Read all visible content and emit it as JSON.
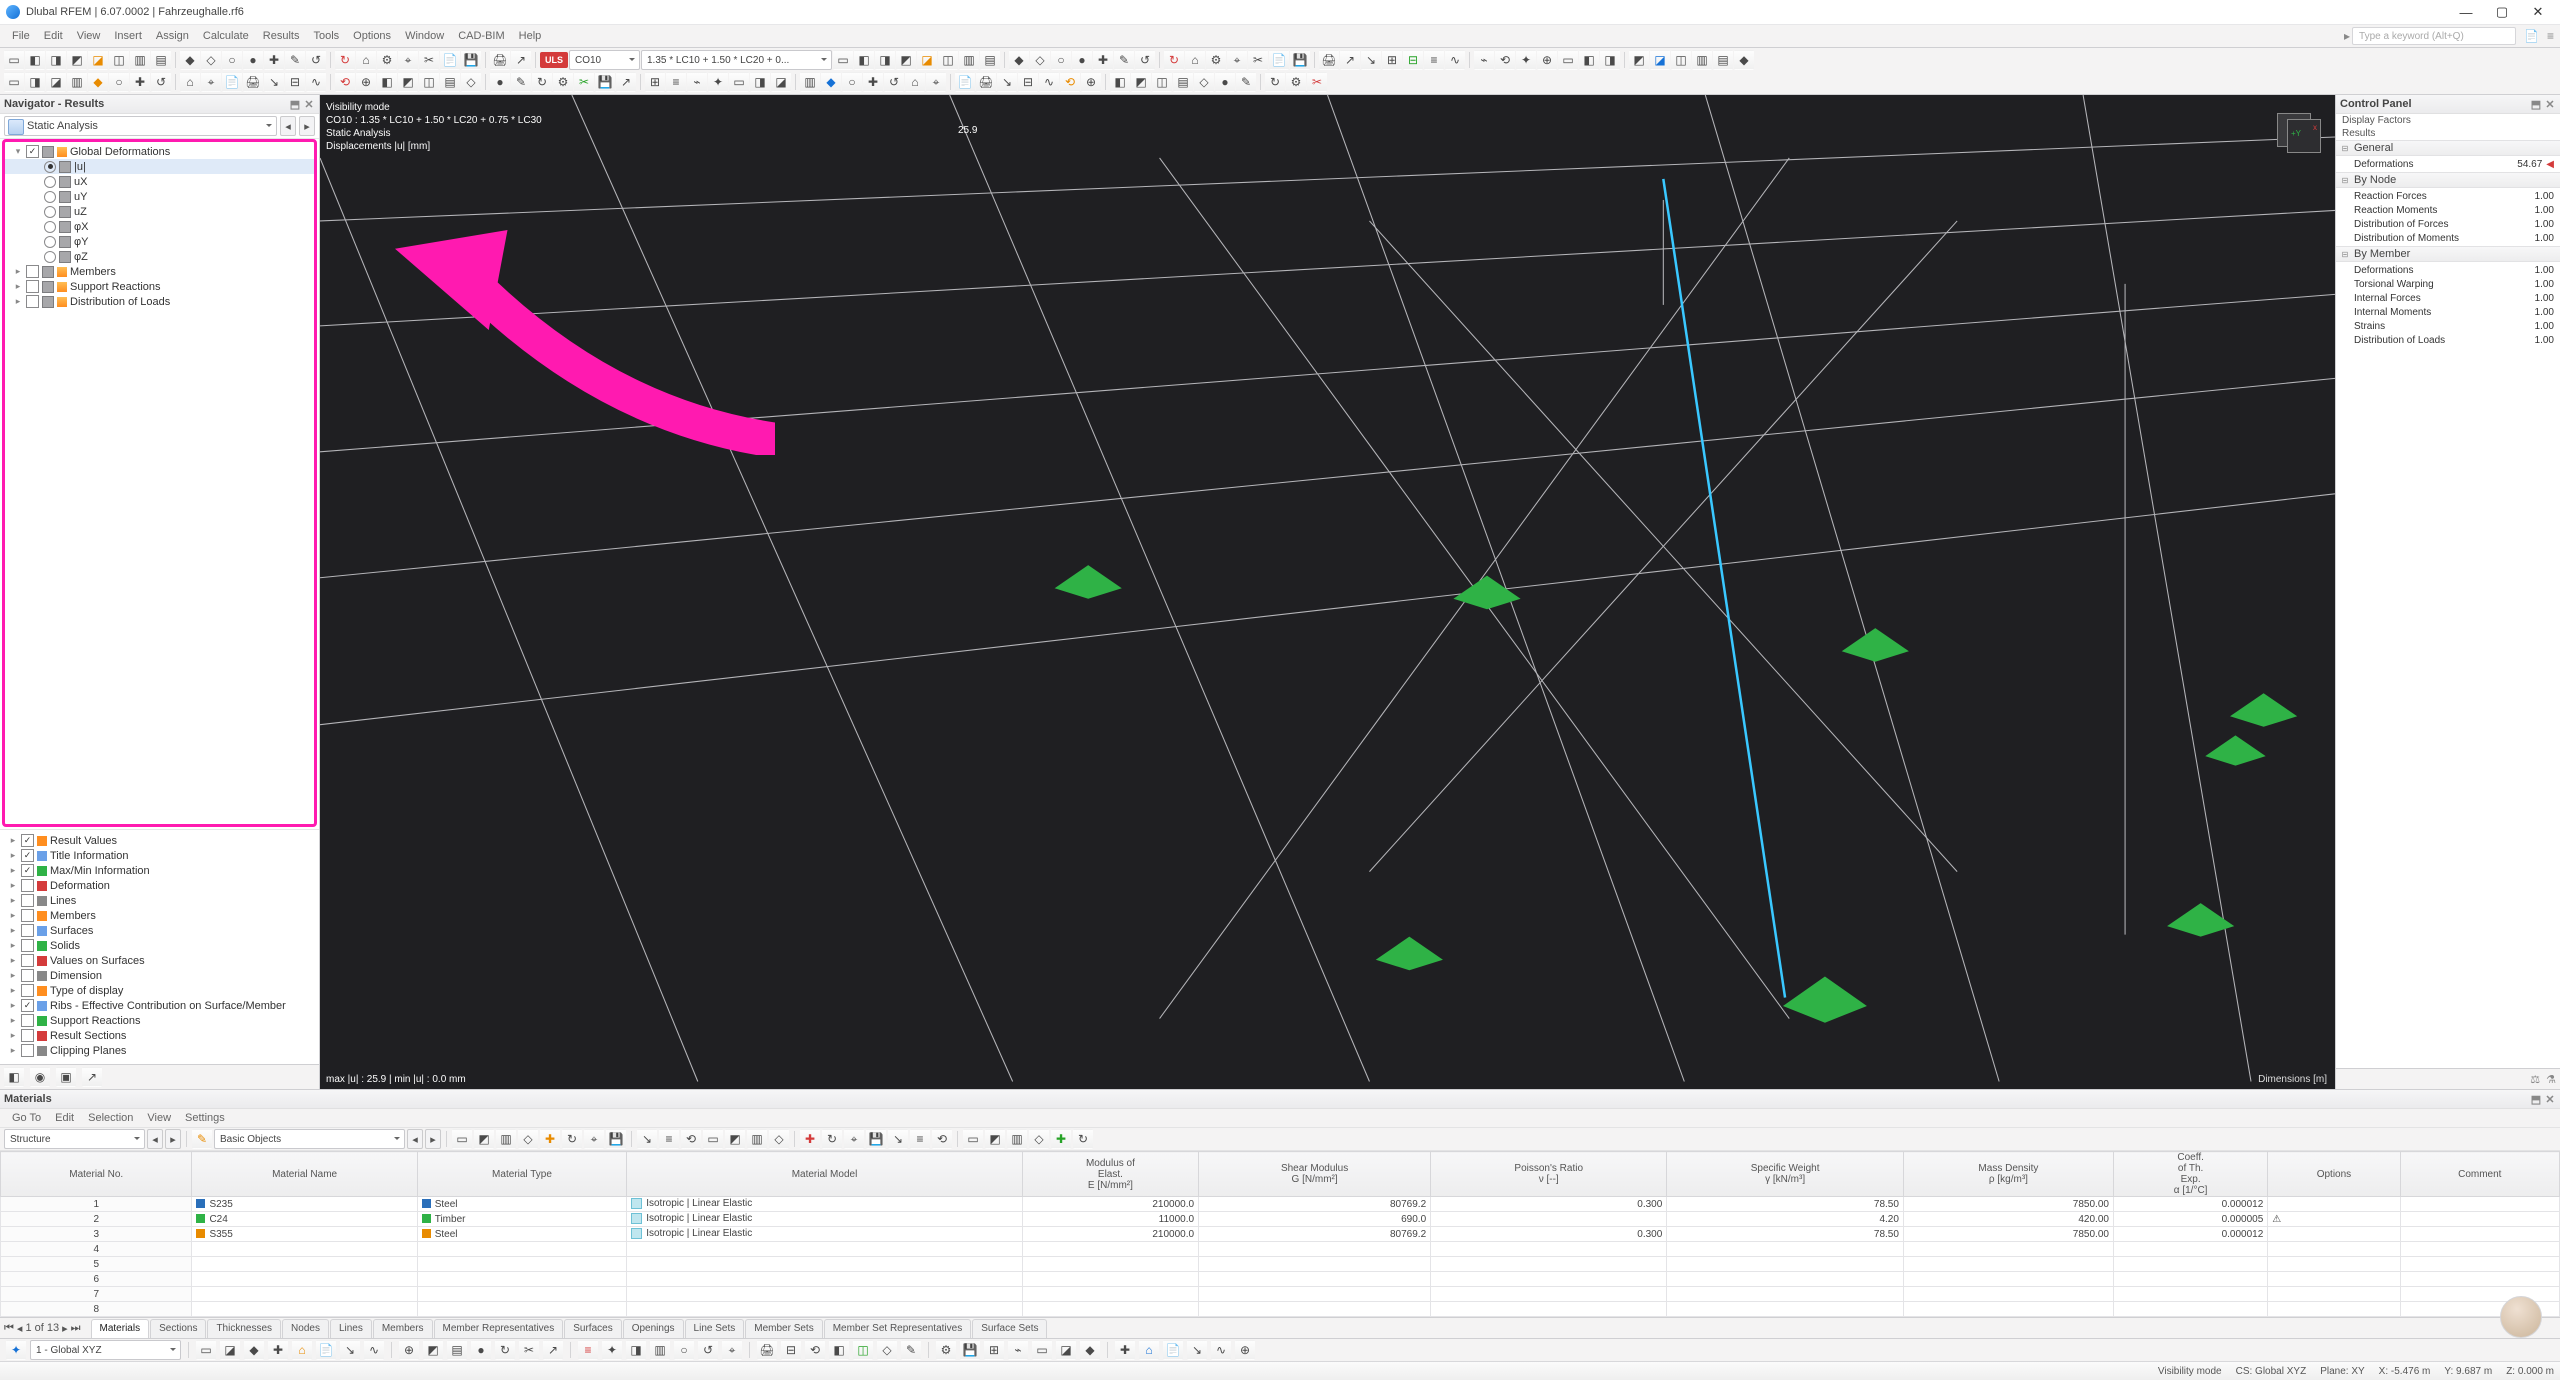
{
  "title": "Dlubal RFEM | 6.07.0002 | Fahrzeughalle.rf6",
  "menu": [
    "File",
    "Edit",
    "View",
    "Insert",
    "Assign",
    "Calculate",
    "Results",
    "Tools",
    "Options",
    "Window",
    "CAD-BIM",
    "Help"
  ],
  "search_placeholder": "Type a keyword (Alt+Q)",
  "uls_tag": "ULS",
  "combo_co": "CO10",
  "combo_formula": "1.35 * LC10 + 1.50 * LC20 + 0...",
  "left_panel": {
    "title": "Navigator - Results",
    "selector": "Static Analysis",
    "global_def": "Global Deformations",
    "deform_opts": [
      "|u|",
      "uX",
      "uY",
      "uZ",
      "φX",
      "φY",
      "φZ"
    ],
    "more_items": [
      "Members",
      "Support Reactions",
      "Distribution of Loads"
    ],
    "lower_items": [
      "Result Values",
      "Title Information",
      "Max/Min Information",
      "Deformation",
      "Lines",
      "Members",
      "Surfaces",
      "Solids",
      "Values on Surfaces",
      "Dimension",
      "Type of display",
      "Ribs - Effective Contribution on Surface/Member",
      "Support Reactions",
      "Result Sections",
      "Clipping Planes"
    ],
    "lower_checked": [
      true,
      true,
      true,
      false,
      false,
      false,
      false,
      false,
      false,
      false,
      false,
      true,
      false,
      false,
      false
    ]
  },
  "viewport_overlay": {
    "l1": "Visibility mode",
    "l2": "CO10 : 1.35 * LC10 + 1.50 * LC20 + 0.75 * LC30",
    "l3": "Static Analysis",
    "l4": "Displacements |u| [mm]",
    "dimlabel": "25.9",
    "bottom": "max |u| : 25.9 | min |u| : 0.0 mm",
    "dims": "Dimensions [m]"
  },
  "right_panel": {
    "title": "Control Panel",
    "sub1": "Display Factors",
    "sub2": "Results",
    "groups": [
      {
        "name": "General",
        "rows": [
          {
            "k": "Deformations",
            "v": "54.67",
            "mark": true
          }
        ]
      },
      {
        "name": "By Node",
        "rows": [
          {
            "k": "Reaction Forces",
            "v": "1.00"
          },
          {
            "k": "Reaction Moments",
            "v": "1.00"
          },
          {
            "k": "Distribution of Forces",
            "v": "1.00"
          },
          {
            "k": "Distribution of Moments",
            "v": "1.00"
          }
        ]
      },
      {
        "name": "By Member",
        "rows": [
          {
            "k": "Deformations",
            "v": "1.00"
          },
          {
            "k": "Torsional Warping",
            "v": "1.00"
          },
          {
            "k": "Internal Forces",
            "v": "1.00"
          },
          {
            "k": "Internal Moments",
            "v": "1.00"
          },
          {
            "k": "Strains",
            "v": "1.00"
          },
          {
            "k": "Distribution of Loads",
            "v": "1.00"
          }
        ]
      }
    ]
  },
  "materials": {
    "title": "Materials",
    "menu": [
      "Go To",
      "Edit",
      "Selection",
      "View",
      "Settings"
    ],
    "structure": "Structure",
    "basic": "Basic Objects",
    "headers": [
      "Material No.",
      "Material Name",
      "Material Type",
      "Material Model",
      "Modulus of Elast. E [N/mm²]",
      "Shear Modulus G [N/mm²]",
      "Poisson's Ratio ν [--]",
      "Specific Weight γ [kN/m³]",
      "Mass Density ρ [kg/m³]",
      "Coeff. of Th. Exp. α [1/°C]",
      "Options",
      "Comment"
    ],
    "rows": [
      {
        "no": "1",
        "name": "S235",
        "type": "Steel",
        "model": "Isotropic | Linear Elastic",
        "E": "210000.0",
        "G": "80769.2",
        "nu": "0.300",
        "gamma": "78.50",
        "rho": "7850.00",
        "alpha": "0.000012",
        "sw": "sw-steel"
      },
      {
        "no": "2",
        "name": "C24",
        "type": "Timber",
        "model": "Isotropic | Linear Elastic",
        "E": "11000.0",
        "G": "690.0",
        "nu": "",
        "gamma": "4.20",
        "rho": "420.00",
        "alpha": "0.000005",
        "sw": "sw-timber",
        "opt": "⚠"
      },
      {
        "no": "3",
        "name": "S355",
        "type": "Steel",
        "model": "Isotropic | Linear Elastic",
        "E": "210000.0",
        "G": "80769.2",
        "nu": "0.300",
        "gamma": "78.50",
        "rho": "7850.00",
        "alpha": "0.000012",
        "sw": "sw-s355"
      }
    ],
    "nav": "1 of 13",
    "tabs": [
      "Materials",
      "Sections",
      "Thicknesses",
      "Nodes",
      "Lines",
      "Members",
      "Member Representatives",
      "Surfaces",
      "Openings",
      "Line Sets",
      "Member Sets",
      "Member Set Representatives",
      "Surface Sets"
    ]
  },
  "status": {
    "cs_combo": "1 - Global XYZ",
    "vis": "Visibility mode",
    "cs": "CS: Global XYZ",
    "plane": "Plane: XY",
    "x": "X: -5.476 m",
    "y": "Y: 9.687 m",
    "z": "Z: 0.000 m"
  }
}
